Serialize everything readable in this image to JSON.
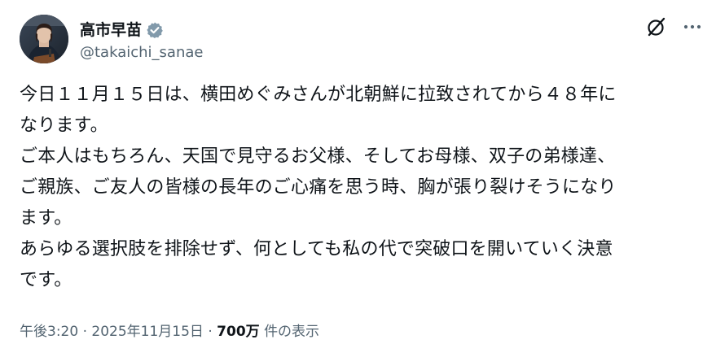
{
  "post": {
    "author": {
      "display_name": "高市早苗",
      "handle": "@takaichi_sanae",
      "verified": true,
      "verified_color": "#829aab"
    },
    "text": "今日１１月１５日は、横田めぐみさんが北朝鮮に拉致されてから４８年に\nなります。\nご本人はもちろん、天国で見守るお父様、そしてお母様、双子の弟様達、\nご親族、ご友人の皆様の長年のご心痛を思う時、胸が張り裂けそうになり\nます。\nあらゆる選択肢を排除せず、何としても私の代で突破口を開いていく決意\nです。",
    "meta": {
      "time": "午後3:20",
      "separator": "·",
      "date": "2025年11月15日",
      "views": "700万",
      "views_label": "件の表示"
    }
  },
  "icons": {
    "grok": "grok-icon",
    "more": "more-icon",
    "verified": "verified-badge-icon"
  },
  "colors": {
    "text_primary": "#0f1419",
    "text_secondary": "#536471",
    "background": "#ffffff"
  }
}
